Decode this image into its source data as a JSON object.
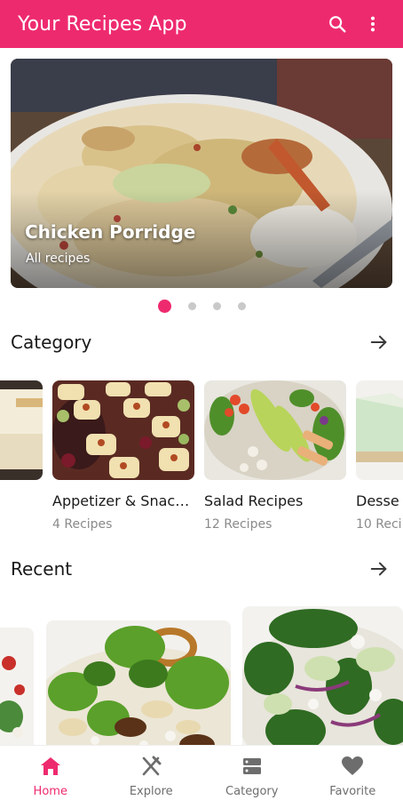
{
  "appbar": {
    "title": "Your Recipes App",
    "icons": [
      "search-icon",
      "more-vert-icon"
    ]
  },
  "hero": {
    "title": "Chicken Porridge",
    "subtitle": "All recipes",
    "slides": 4,
    "active_slide": 1
  },
  "sections": {
    "category_title": "Category",
    "recent_title": "Recent"
  },
  "categories": [
    {
      "name": "Appetizer & Snac…",
      "count": "4 Recipes"
    },
    {
      "name": "Salad Recipes",
      "count": "12 Recipes"
    },
    {
      "name": "Desse",
      "count": "10 Reci"
    }
  ],
  "nav": {
    "items": [
      {
        "label": "Home",
        "icon": "home-icon",
        "active": true
      },
      {
        "label": "Explore",
        "icon": "utensils-icon",
        "active": false
      },
      {
        "label": "Category",
        "icon": "category-list-icon",
        "active": false
      },
      {
        "label": "Favorite",
        "icon": "heart-icon",
        "active": false
      }
    ]
  },
  "colors": {
    "accent": "#ee2a6f",
    "inactive_nav": "#6d6d6d",
    "muted_text": "#8a8a8a"
  }
}
